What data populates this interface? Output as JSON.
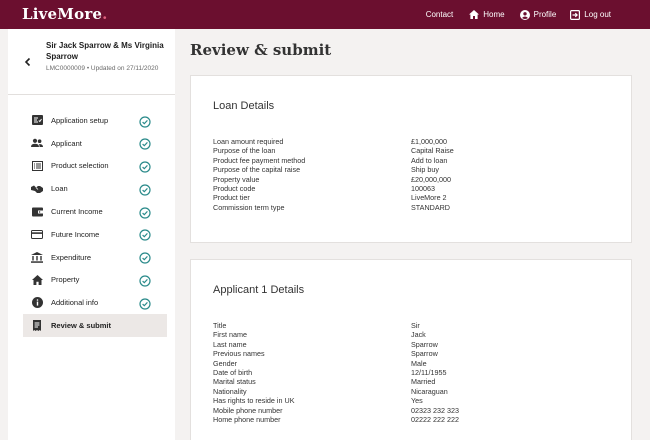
{
  "header": {
    "logo": "LiveMore",
    "logo_dot": ".",
    "nav": {
      "contact": "Contact",
      "home": "Home",
      "profile": "Profile",
      "logout": "Log out"
    }
  },
  "sidebar": {
    "client_name": "Sir Jack Sparrow & Ms Virginia Sparrow",
    "client_meta": "LMC0000009 • Updated on 27/11/2020",
    "steps": [
      {
        "label": "Application setup",
        "icon": "application-setup-icon",
        "complete": true
      },
      {
        "label": "Applicant",
        "icon": "people-icon",
        "complete": true
      },
      {
        "label": "Product selection",
        "icon": "list-icon",
        "complete": true
      },
      {
        "label": "Loan",
        "icon": "handshake-icon",
        "complete": true
      },
      {
        "label": "Current Income",
        "icon": "wallet-icon",
        "complete": true
      },
      {
        "label": "Future Income",
        "icon": "card-icon",
        "complete": true
      },
      {
        "label": "Expenditure",
        "icon": "bank-icon",
        "complete": true
      },
      {
        "label": "Property",
        "icon": "house-icon",
        "complete": true
      },
      {
        "label": "Additional info",
        "icon": "info-icon",
        "complete": true
      },
      {
        "label": "Review & submit",
        "icon": "receipt-icon",
        "complete": false,
        "active": true
      }
    ]
  },
  "main": {
    "title": "Review & submit",
    "loan_details": {
      "title": "Loan Details",
      "rows": [
        {
          "key": "Loan amount required",
          "value": "£1,000,000"
        },
        {
          "key": "Purpose of the loan",
          "value": "Capital Raise"
        },
        {
          "key": "Product fee payment method",
          "value": "Add to loan"
        },
        {
          "key": "Purpose of the capital raise",
          "value": "Ship buy"
        },
        {
          "key": "Property value",
          "value": "£20,000,000"
        },
        {
          "key": "Product code",
          "value": "100063"
        },
        {
          "key": "Product tier",
          "value": "LiveMore 2"
        },
        {
          "key": "Commission term type",
          "value": "STANDARD"
        }
      ]
    },
    "applicant_details": {
      "title": "Applicant 1 Details",
      "rows": [
        {
          "key": "Title",
          "value": "Sir"
        },
        {
          "key": "First name",
          "value": "Jack"
        },
        {
          "key": "Last name",
          "value": "Sparrow"
        },
        {
          "key": "Previous names",
          "value": "Sparrow"
        },
        {
          "key": "Gender",
          "value": "Male"
        },
        {
          "key": "Date of birth",
          "value": "12/11/1955"
        },
        {
          "key": "Marital status",
          "value": "Married"
        },
        {
          "key": "Nationality",
          "value": "Nicaraguan"
        },
        {
          "key": "Has rights to reside in UK",
          "value": "Yes"
        },
        {
          "key": "Mobile phone number",
          "value": "02323 232 323"
        },
        {
          "key": "Home phone number",
          "value": "02222 222 222"
        }
      ]
    }
  },
  "colors": {
    "brand": "#6b0f2f",
    "check": "#2a8a8a",
    "background": "#f4f2f1"
  }
}
